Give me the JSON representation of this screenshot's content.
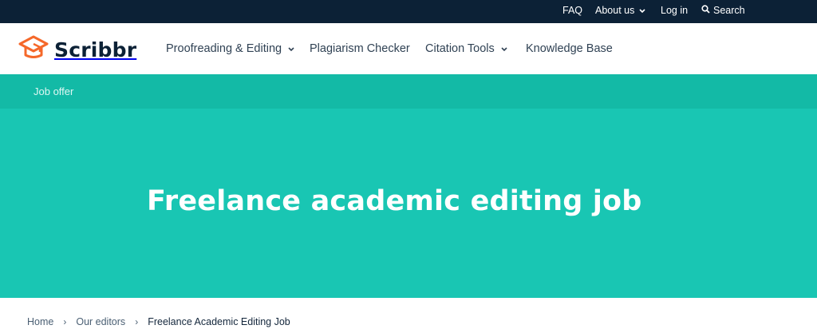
{
  "topbar": {
    "faq": "FAQ",
    "about": "About us",
    "login": "Log in",
    "search": "Search"
  },
  "brand": {
    "name": "Scribbr",
    "accent": "#f5682a"
  },
  "nav": {
    "proofreading": "Proofreading & Editing",
    "plagiarism": "Plagiarism Checker",
    "citation": "Citation Tools",
    "knowledge": "Knowledge Base"
  },
  "subbar": {
    "label": "Job offer"
  },
  "hero": {
    "title": "Freelance academic editing job"
  },
  "breadcrumb": {
    "home": "Home",
    "separator": "›",
    "editors": "Our editors",
    "current": "Freelance Academic Editing Job"
  },
  "colors": {
    "topbar": "#0c2136",
    "subbar": "#13baa6",
    "hero": "#19c6b3"
  },
  "icons": [
    "chevron-down-icon",
    "search-icon",
    "scribbr-logo-icon"
  ]
}
